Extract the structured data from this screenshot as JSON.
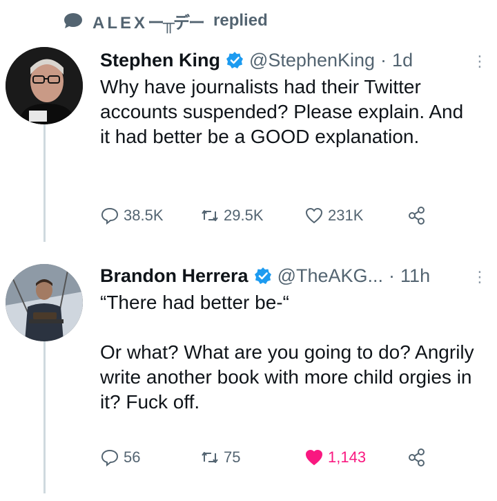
{
  "reply_header": {
    "name": "ALEX",
    "name_suffix": "ー╥デー",
    "verb": "replied"
  },
  "tweets": [
    {
      "display_name": "Stephen King",
      "handle": "@StephenKing",
      "separator": "·",
      "time": "1d",
      "text": "Why have journalists had their Twitter accounts suspended? Please explain. And it had better be a GOOD explanation.",
      "replies": "38.5K",
      "retweets": "29.5K",
      "likes": "231K",
      "liked": false
    },
    {
      "display_name": "Brandon Herrera",
      "handle": "@TheAKG...",
      "separator": "·",
      "time": "11h",
      "text": "“There had better be-“\n\nOr what? What are you going to do? Angrily write another book with more child orgies in it? Fuck off.",
      "replies": "56",
      "retweets": "75",
      "likes": "1,143",
      "liked": true
    }
  ],
  "colors": {
    "verified": "#1d9bf0",
    "like_active": "#f91880",
    "muted": "#536471"
  },
  "icons": [
    "reply-icon",
    "retweet-icon",
    "like-icon",
    "share-icon",
    "verified-badge-icon",
    "more-icon"
  ]
}
